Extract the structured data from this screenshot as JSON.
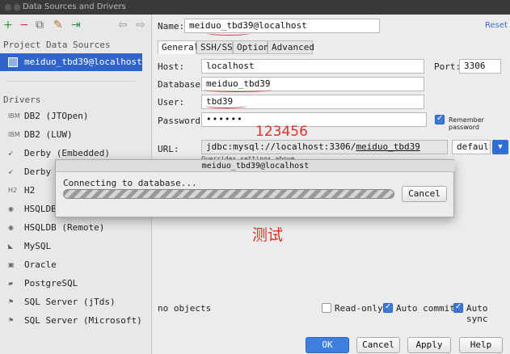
{
  "window": {
    "title": "Data Sources and Drivers"
  },
  "left": {
    "toolbar": {
      "add": "+",
      "remove": "−",
      "copy": "⧉",
      "tools": "✎",
      "import": "⇥",
      "back": "⇦",
      "forward": "⇨"
    },
    "project_section_title": "Project Data Sources",
    "project_item": "meiduo_tbd39@localhost",
    "drivers_section_title": "Drivers",
    "drivers": [
      {
        "label": "DB2 (JTOpen)",
        "icon": "IBM"
      },
      {
        "label": "DB2 (LUW)",
        "icon": "IBM"
      },
      {
        "label": "Derby (Embedded)",
        "icon": "feather"
      },
      {
        "label": "Derby (",
        "icon": "feather"
      },
      {
        "label": "H2",
        "icon": "H2"
      },
      {
        "label": "HSQLDB",
        "icon": "db"
      },
      {
        "label": "HSQLDB (Remote)",
        "icon": "db"
      },
      {
        "label": "MySQL",
        "icon": "dolphin"
      },
      {
        "label": "Oracle",
        "icon": "oracle"
      },
      {
        "label": "PostgreSQL",
        "icon": "elephant"
      },
      {
        "label": "SQL Server (jTds)",
        "icon": "sqlserver"
      },
      {
        "label": "SQL Server (Microsoft)",
        "icon": "sqlserver"
      }
    ]
  },
  "form": {
    "name_label": "Name:",
    "name_value": "meiduo_tbd39@localhost",
    "reset": "Reset",
    "tabs": [
      "General",
      "SSH/SSL",
      "Options",
      "Advanced"
    ],
    "host_label": "Host:",
    "host_value": "localhost",
    "port_label": "Port:",
    "port_value": "3306",
    "database_label": "Database:",
    "database_value": "meiduo_tbd39",
    "user_label": "User:",
    "user_value": "tbd39",
    "password_label": "Password:",
    "password_value": "••••••",
    "remember_label": "Remember password",
    "url_label": "URL:",
    "url_prefix": "jdbc:mysql://localhost:3306/",
    "url_db": "meiduo_tbd39",
    "url_hint": "Overrides settings above",
    "url_mode": "default",
    "status": "no objects",
    "readonly_label": "Read-only",
    "autocommit_label": "Auto commit",
    "autosync_label": "Auto sync"
  },
  "dialog": {
    "title": "meiduo_tbd39@localhost",
    "message": "Connecting to database...",
    "cancel": "Cancel"
  },
  "buttons": {
    "ok": "OK",
    "cancel": "Cancel",
    "apply": "Apply",
    "help": "Help"
  },
  "annotations": {
    "password_note": "123456",
    "test_note": "测试"
  },
  "colors": {
    "selection": "#2f65ca",
    "annotation": "#e0302a",
    "primary_button": "#3e7fe0"
  }
}
